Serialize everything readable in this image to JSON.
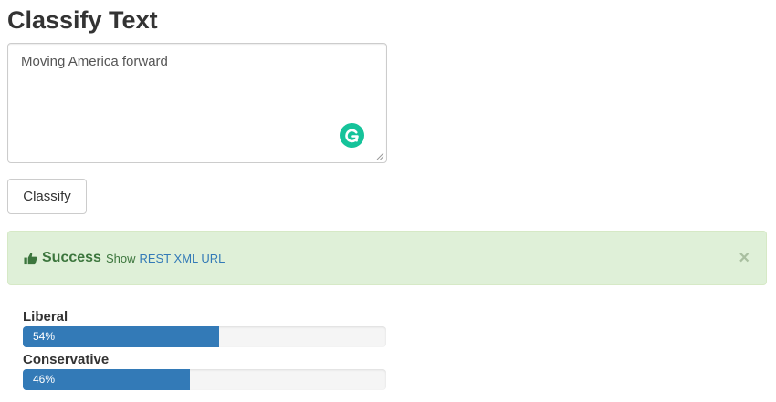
{
  "page": {
    "title": "Classify Text"
  },
  "input": {
    "value": "Moving America forward"
  },
  "actions": {
    "classify_label": "Classify"
  },
  "alert": {
    "status": "Success",
    "show_label": "Show",
    "link_label": "REST XML URL",
    "close_symbol": "×",
    "icon": "thumbs-up-icon"
  },
  "results": [
    {
      "label": "Liberal",
      "percent_text": "54%",
      "percent": 54
    },
    {
      "label": "Conservative",
      "percent_text": "46%",
      "percent": 46
    }
  ],
  "colors": {
    "progress_fill": "#337ab7",
    "success_text": "#3c763d",
    "alert_bg": "#dff0d8",
    "grammarly": "#15c39a"
  }
}
